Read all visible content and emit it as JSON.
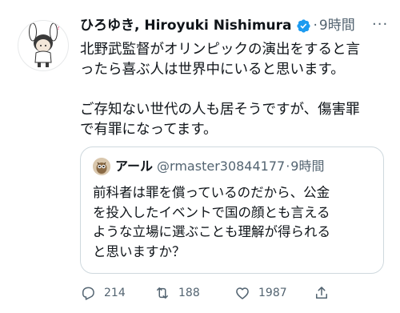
{
  "tweet": {
    "display_name": "ひろゆき, Hiroyuki Nishimura",
    "separator": "·",
    "time": "9時間",
    "more_label": "···",
    "body_lines": [
      "北野武監督がオリンピックの演出をすると言",
      "ったら喜ぶ人は世界中にいると思います。",
      "",
      "ご存知ない世代の人も居そうですが、傷害罪",
      "で有罪になってます。"
    ]
  },
  "quoted": {
    "display_name": "アール",
    "handle": "@rmaster30844177",
    "separator": "·",
    "time": "9時間",
    "body_lines": [
      "前科者は罪を償っているのだから、公金",
      "を投入したイベントで国の顔とも言える",
      "ような立場に選ぶことも理解が得られる",
      "と思いますか？"
    ]
  },
  "actions": {
    "reply_count": "214",
    "retweet_count": "188",
    "like_count": "1987"
  },
  "colors": {
    "verified": "#1d9bf0",
    "secondary_text": "#536471",
    "border": "#cfd9de"
  },
  "icons": [
    "verified-badge-icon",
    "reply-icon",
    "retweet-icon",
    "like-icon",
    "share-icon"
  ]
}
